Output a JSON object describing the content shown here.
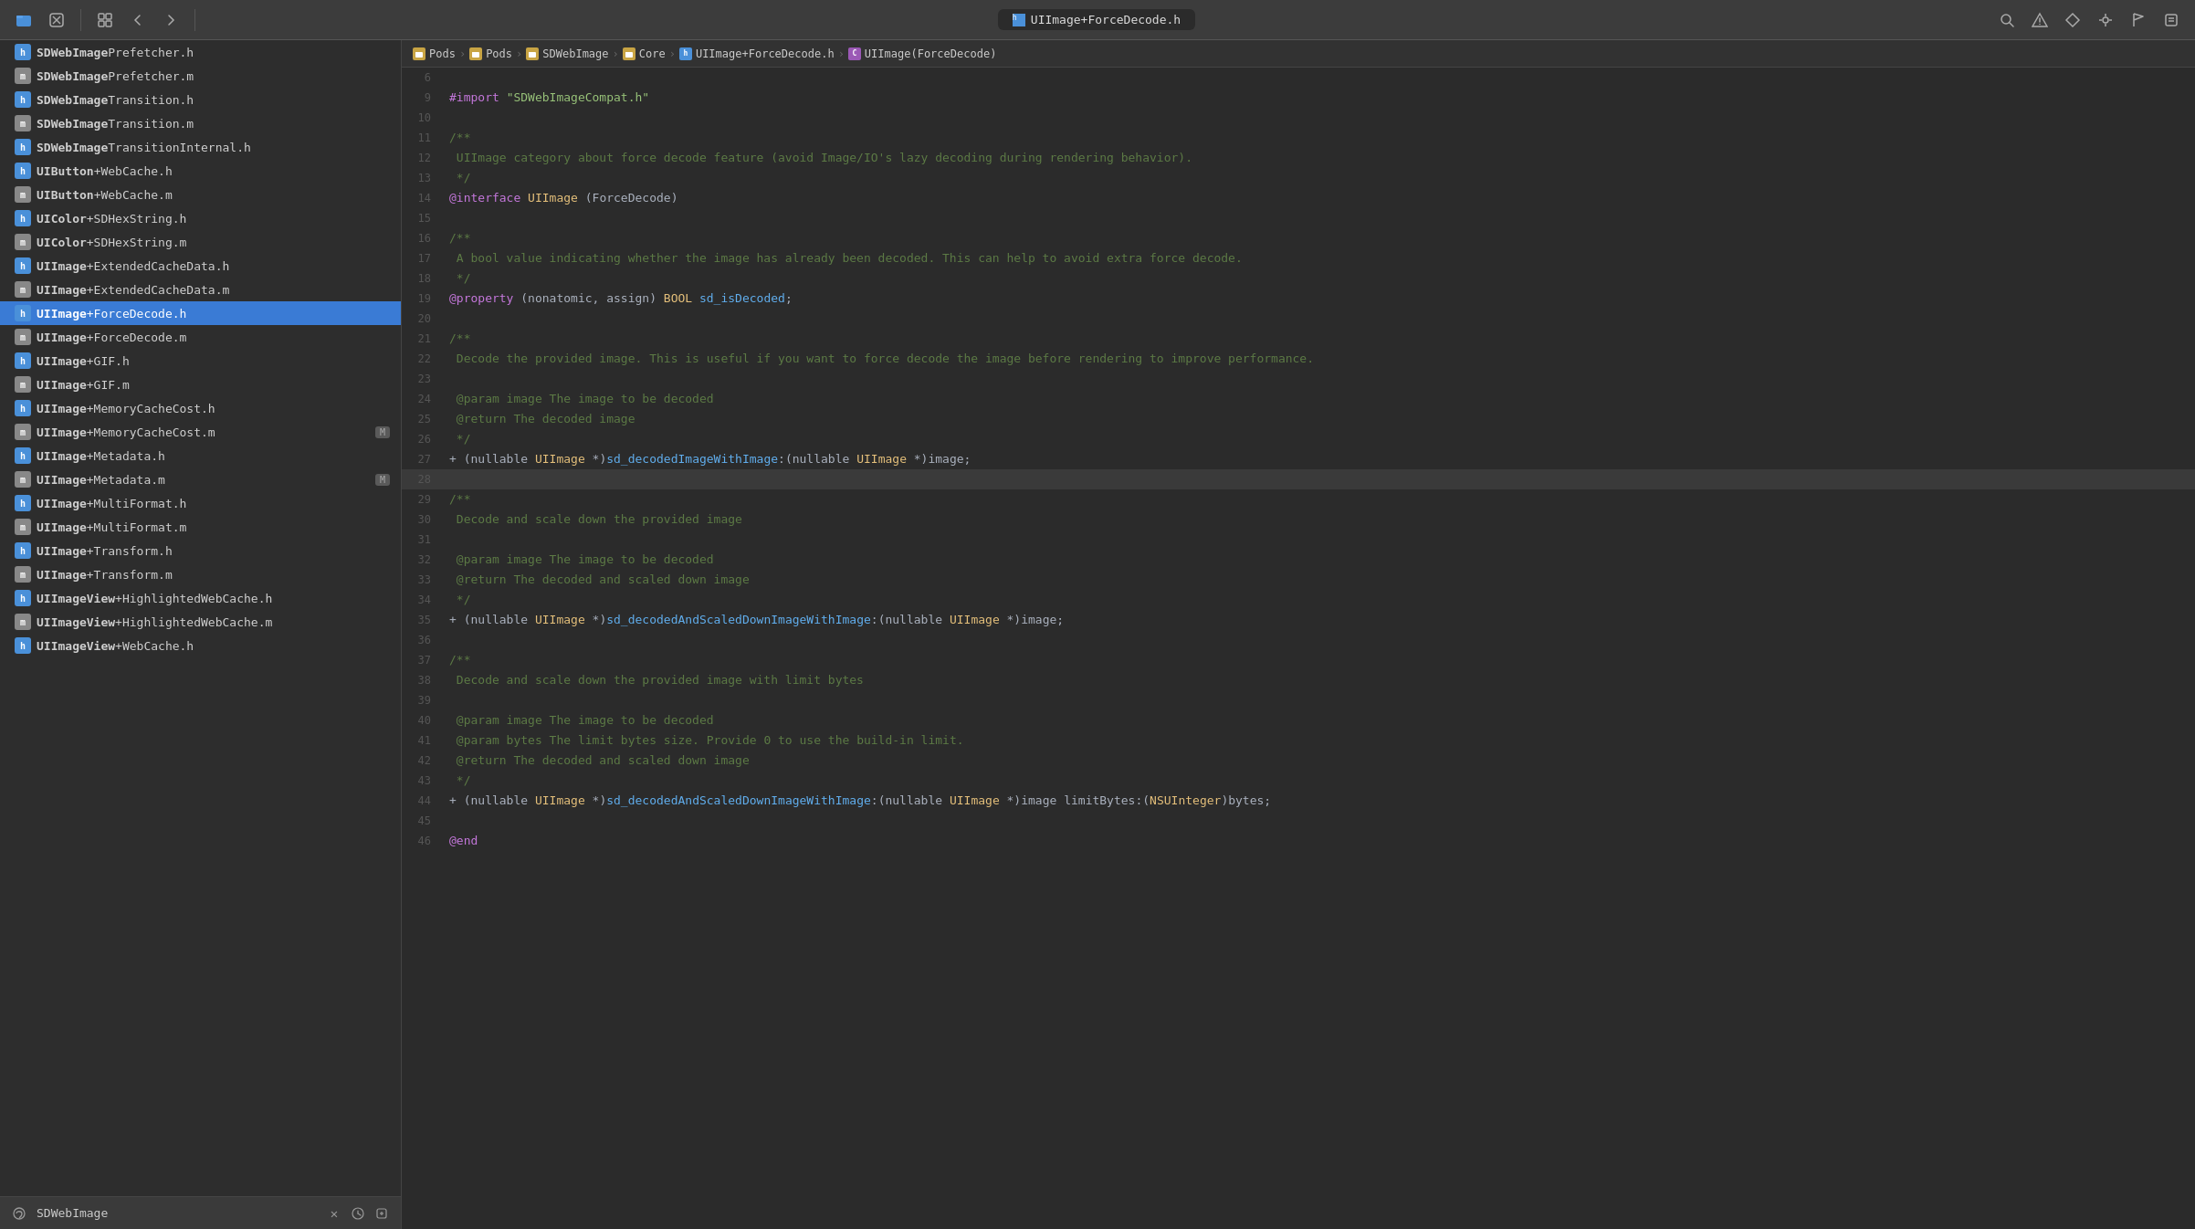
{
  "toolbar": {
    "icons": [
      {
        "name": "folder-icon",
        "symbol": "📁"
      },
      {
        "name": "stop-icon",
        "symbol": "⊠"
      },
      {
        "name": "grid-icon",
        "symbol": "⊞"
      },
      {
        "name": "search-icon",
        "symbol": "⌕"
      },
      {
        "name": "warning-icon",
        "symbol": "△"
      },
      {
        "name": "diamond-icon",
        "symbol": "◇"
      },
      {
        "name": "tools-icon",
        "symbol": "⚙"
      },
      {
        "name": "flag-icon",
        "symbol": "⚑"
      },
      {
        "name": "note-icon",
        "symbol": "≡"
      }
    ],
    "nav_back": "‹",
    "nav_forward": "›"
  },
  "sidebar": {
    "footer_name": "SDWebImage",
    "files": [
      {
        "name": "SDWebImage",
        "ext": "Prefetcher.h",
        "type": "h"
      },
      {
        "name": "SDWebImage",
        "ext": "Prefetcher.m",
        "type": "m"
      },
      {
        "name": "SDWebImage",
        "ext": "Transition.h",
        "type": "h"
      },
      {
        "name": "SDWebImage",
        "ext": "Transition.m",
        "type": "m"
      },
      {
        "name": "SDWebImage",
        "ext": "TransitionInternal.h",
        "type": "h"
      },
      {
        "name": "UIButton",
        "ext": "+WebCache.h",
        "type": "h"
      },
      {
        "name": "UIButton",
        "ext": "+WebCache.m",
        "type": "m"
      },
      {
        "name": "UIColor",
        "ext": "+SDHexString.h",
        "type": "h"
      },
      {
        "name": "UIColor",
        "ext": "+SDHexString.m",
        "type": "m"
      },
      {
        "name": "UIImage",
        "ext": "+ExtendedCacheData.h",
        "type": "h"
      },
      {
        "name": "UIImage",
        "ext": "+ExtendedCacheData.m",
        "type": "m"
      },
      {
        "name": "UIImage",
        "ext": "+ForceDecode.h",
        "type": "h",
        "selected": true
      },
      {
        "name": "UIImage",
        "ext": "+ForceDecode.m",
        "type": "m"
      },
      {
        "name": "UIImage",
        "ext": "+GIF.h",
        "type": "h"
      },
      {
        "name": "UIImage",
        "ext": "+GIF.m",
        "type": "m"
      },
      {
        "name": "UIImage",
        "ext": "+MemoryCacheCost.h",
        "type": "h"
      },
      {
        "name": "UIImage",
        "ext": "+MemoryCacheCost.m",
        "type": "m",
        "badge": "M"
      },
      {
        "name": "UIImage",
        "ext": "+Metadata.h",
        "type": "h"
      },
      {
        "name": "UIImage",
        "ext": "+Metadata.m",
        "type": "m",
        "badge": "M"
      },
      {
        "name": "UIImage",
        "ext": "+MultiFormat.h",
        "type": "h"
      },
      {
        "name": "UIImage",
        "ext": "+MultiFormat.m",
        "type": "m"
      },
      {
        "name": "UIImage",
        "ext": "+Transform.h",
        "type": "h"
      },
      {
        "name": "UIImage",
        "ext": "+Transform.m",
        "type": "m"
      },
      {
        "name": "UIImageView",
        "ext": "+HighlightedWebCache.h",
        "type": "h"
      },
      {
        "name": "UIImageView",
        "ext": "+HighlightedWebCache.m",
        "type": "m"
      },
      {
        "name": "UIImageView",
        "ext": "+WebCache.h",
        "type": "h"
      }
    ]
  },
  "tab": {
    "label": "UIImage+ForceDecode.h",
    "icon_type": "h"
  },
  "breadcrumb": {
    "items": [
      {
        "label": "Pods",
        "icon": "folder"
      },
      {
        "label": "Pods",
        "icon": "folder"
      },
      {
        "label": "SDWebImage",
        "icon": "folder"
      },
      {
        "label": "Core",
        "icon": "folder"
      },
      {
        "label": "UIImage+ForceDecode.h",
        "icon": "h"
      },
      {
        "label": "UIImage(ForceDecode)",
        "icon": "c"
      }
    ]
  },
  "code": {
    "lines": [
      {
        "num": 6,
        "content": ""
      },
      {
        "num": 9,
        "tokens": [
          {
            "t": "kw",
            "v": "#import"
          },
          {
            "t": "normal",
            "v": " "
          },
          {
            "t": "str",
            "v": "\"SDWebImageCompat.h\""
          }
        ]
      },
      {
        "num": 10,
        "content": ""
      },
      {
        "num": 11,
        "tokens": [
          {
            "t": "comment",
            "v": "/**"
          }
        ]
      },
      {
        "num": 12,
        "tokens": [
          {
            "t": "comment",
            "v": " UIImage category about force decode feature (avoid Image/IO's lazy decoding during rendering behavior)."
          }
        ]
      },
      {
        "num": 13,
        "tokens": [
          {
            "t": "comment",
            "v": " */"
          }
        ]
      },
      {
        "num": 14,
        "tokens": [
          {
            "t": "kw",
            "v": "@interface"
          },
          {
            "t": "normal",
            "v": " "
          },
          {
            "t": "type",
            "v": "UIImage"
          },
          {
            "t": "normal",
            "v": " (ForceDecode)"
          }
        ]
      },
      {
        "num": 15,
        "content": ""
      },
      {
        "num": 16,
        "tokens": [
          {
            "t": "comment",
            "v": "/**"
          }
        ]
      },
      {
        "num": 17,
        "tokens": [
          {
            "t": "comment",
            "v": " A bool value indicating whether the image has already been decoded. This can help to avoid extra force decode."
          }
        ]
      },
      {
        "num": 18,
        "tokens": [
          {
            "t": "comment",
            "v": " */"
          }
        ]
      },
      {
        "num": 19,
        "tokens": [
          {
            "t": "kw",
            "v": "@property"
          },
          {
            "t": "normal",
            "v": " (nonatomic, assign) "
          },
          {
            "t": "type",
            "v": "BOOL"
          },
          {
            "t": "normal",
            "v": " "
          },
          {
            "t": "method",
            "v": "sd_isDecoded"
          },
          {
            "t": "normal",
            "v": ";"
          }
        ]
      },
      {
        "num": 20,
        "content": ""
      },
      {
        "num": 21,
        "tokens": [
          {
            "t": "comment",
            "v": "/**"
          }
        ]
      },
      {
        "num": 22,
        "tokens": [
          {
            "t": "comment",
            "v": " Decode the provided image. This is useful if you want to force decode the image before rendering to improve performance."
          }
        ]
      },
      {
        "num": 23,
        "content": ""
      },
      {
        "num": 24,
        "tokens": [
          {
            "t": "comment",
            "v": " @param"
          },
          {
            "t": "comment",
            "v": " image The image to be decoded"
          }
        ]
      },
      {
        "num": 25,
        "tokens": [
          {
            "t": "comment",
            "v": " @return"
          },
          {
            "t": "comment",
            "v": " The decoded image"
          }
        ]
      },
      {
        "num": 26,
        "tokens": [
          {
            "t": "comment",
            "v": " */"
          }
        ]
      },
      {
        "num": 27,
        "tokens": [
          {
            "t": "normal",
            "v": "+ ("
          },
          {
            "t": "normal",
            "v": "nullable "
          },
          {
            "t": "type",
            "v": "UIImage"
          },
          {
            "t": "normal",
            "v": " *)"
          },
          {
            "t": "method",
            "v": "sd_decodedImageWithImage"
          },
          {
            "t": "normal",
            "v": ":("
          },
          {
            "t": "normal",
            "v": "nullable "
          },
          {
            "t": "type",
            "v": "UIImage"
          },
          {
            "t": "normal",
            "v": " *)image;"
          }
        ]
      },
      {
        "num": 28,
        "content": "",
        "highlighted": true
      },
      {
        "num": 29,
        "tokens": [
          {
            "t": "comment",
            "v": "/**"
          }
        ]
      },
      {
        "num": 30,
        "tokens": [
          {
            "t": "comment",
            "v": " Decode and scale down the provided image"
          }
        ]
      },
      {
        "num": 31,
        "content": ""
      },
      {
        "num": 32,
        "tokens": [
          {
            "t": "comment",
            "v": " @param"
          },
          {
            "t": "comment",
            "v": " image The image to be decoded"
          }
        ]
      },
      {
        "num": 33,
        "tokens": [
          {
            "t": "comment",
            "v": " @return"
          },
          {
            "t": "comment",
            "v": " The decoded and scaled down image"
          }
        ]
      },
      {
        "num": 34,
        "tokens": [
          {
            "t": "comment",
            "v": " */"
          }
        ]
      },
      {
        "num": 35,
        "tokens": [
          {
            "t": "normal",
            "v": "+ ("
          },
          {
            "t": "normal",
            "v": "nullable "
          },
          {
            "t": "type",
            "v": "UIImage"
          },
          {
            "t": "normal",
            "v": " *)"
          },
          {
            "t": "method",
            "v": "sd_decodedAndScaledDownImageWithImage"
          },
          {
            "t": "normal",
            "v": ":("
          },
          {
            "t": "normal",
            "v": "nullable "
          },
          {
            "t": "type",
            "v": "UIImage"
          },
          {
            "t": "normal",
            "v": " *)image;"
          }
        ]
      },
      {
        "num": 36,
        "content": ""
      },
      {
        "num": 37,
        "tokens": [
          {
            "t": "comment",
            "v": "/**"
          }
        ]
      },
      {
        "num": 38,
        "tokens": [
          {
            "t": "comment",
            "v": " Decode and scale down the provided image with limit bytes"
          }
        ]
      },
      {
        "num": 39,
        "content": ""
      },
      {
        "num": 40,
        "tokens": [
          {
            "t": "comment",
            "v": " @param"
          },
          {
            "t": "comment",
            "v": " image The image to be decoded"
          }
        ]
      },
      {
        "num": 41,
        "tokens": [
          {
            "t": "comment",
            "v": " @param"
          },
          {
            "t": "comment",
            "v": " bytes The limit bytes size. Provide 0 to use the build-in limit."
          }
        ]
      },
      {
        "num": 42,
        "tokens": [
          {
            "t": "comment",
            "v": " @return"
          },
          {
            "t": "comment",
            "v": " The decoded and scaled down image"
          }
        ]
      },
      {
        "num": 43,
        "tokens": [
          {
            "t": "comment",
            "v": " */"
          }
        ]
      },
      {
        "num": 44,
        "tokens": [
          {
            "t": "normal",
            "v": "+ ("
          },
          {
            "t": "normal",
            "v": "nullable "
          },
          {
            "t": "type",
            "v": "UIImage"
          },
          {
            "t": "normal",
            "v": " *)"
          },
          {
            "t": "method",
            "v": "sd_decodedAndScaledDownImageWithImage"
          },
          {
            "t": "normal",
            "v": ":("
          },
          {
            "t": "normal",
            "v": "nullable "
          },
          {
            "t": "type",
            "v": "UIImage"
          },
          {
            "t": "normal",
            "v": " *)image limitBytes:("
          },
          {
            "t": "type",
            "v": "NSUInteger"
          },
          {
            "t": "normal",
            "v": ")bytes;"
          }
        ]
      },
      {
        "num": 45,
        "content": ""
      },
      {
        "num": 46,
        "tokens": [
          {
            "t": "kw",
            "v": "@end"
          }
        ]
      }
    ]
  }
}
